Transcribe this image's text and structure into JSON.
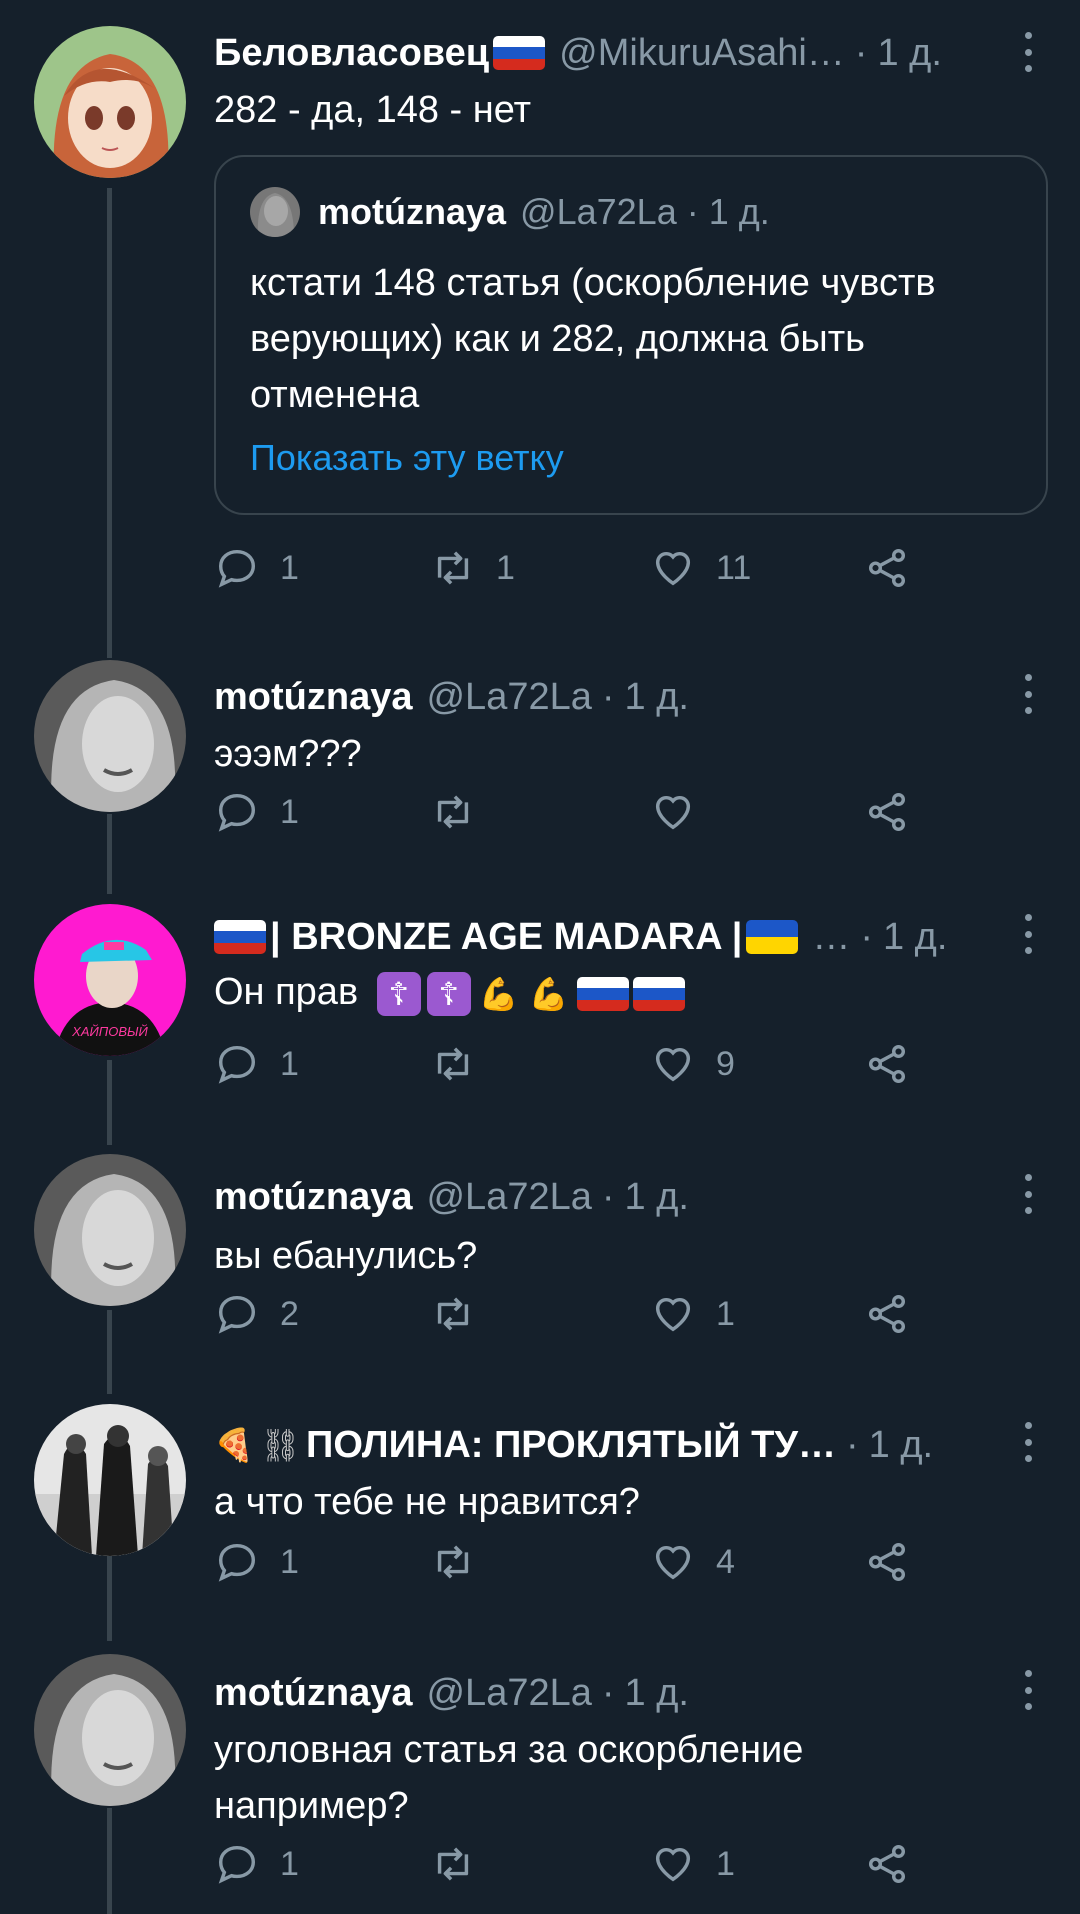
{
  "colors": {
    "background": "#15202b",
    "text_primary": "#ffffff",
    "text_secondary": "#8899a6",
    "link": "#1d9bf0",
    "border": "#38444d"
  },
  "tweets": [
    {
      "name": "Беловласовец",
      "handle": "@MikuruAsahi…",
      "time": "1 д.",
      "text": "282 - да, 148 - нет",
      "quote": {
        "name": "motúznaya",
        "handle": "@La72La",
        "time": "1 д.",
        "text": "кстати 148 статья (оскорбление чувств верующих) как и 282, должна быть отменена",
        "link": "Показать эту ветку"
      },
      "replies": "1",
      "retweets": "1",
      "likes": "11"
    },
    {
      "name": "motúznaya",
      "handle": "@La72La",
      "time": "1 д.",
      "text": "эээм???",
      "replies": "1",
      "retweets": "",
      "likes": ""
    },
    {
      "name": " | BRONZE AGE MADARA | ",
      "handle": "…",
      "time": "1 д.",
      "text": "Он прав",
      "avatar_caption": "ХАЙПОВЫЙ",
      "replies": "1",
      "retweets": "",
      "likes": "9"
    },
    {
      "name": "motúznaya",
      "handle": "@La72La",
      "time": "1 д.",
      "text": "вы ебанулись?",
      "replies": "2",
      "retweets": "",
      "likes": "1"
    },
    {
      "name": "ПОЛИНА: ПРОКЛЯТЫЙ ТУ…",
      "time": "1 д.",
      "text": "а что тебе не нравится?",
      "replies": "1",
      "retweets": "",
      "likes": "4"
    },
    {
      "name": "motúznaya",
      "handle": "@La72La",
      "time": "1 д.",
      "text": "уголовная статья за оскорбление например?",
      "replies": "1",
      "retweets": "",
      "likes": "1"
    }
  ],
  "icons": {
    "reply": "reply-icon",
    "retweet": "retweet-icon",
    "like": "heart-icon",
    "share": "share-icon",
    "more": "more-vertical-icon"
  }
}
